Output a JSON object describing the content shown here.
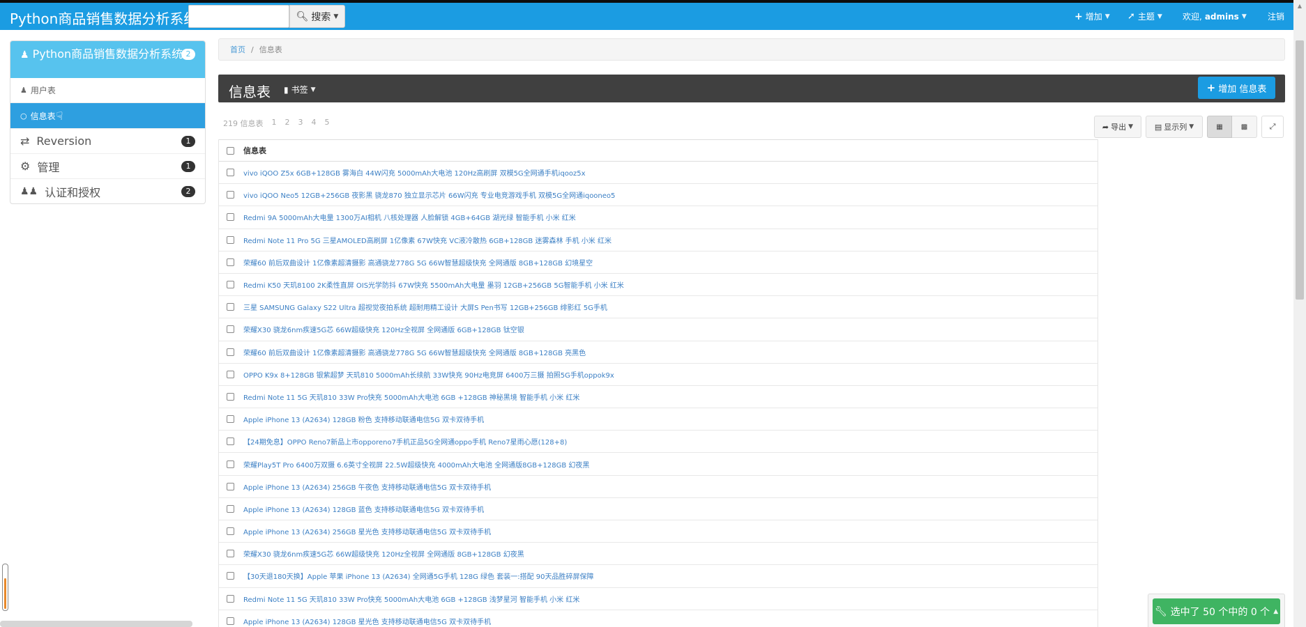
{
  "navbar": {
    "brand": "Python商品销售数据分析系统",
    "search_value": "",
    "search_label": "搜索",
    "add_label": "增加",
    "theme_label": "主题",
    "welcome_label": "欢迎,",
    "user_label": "admins",
    "logout_label": "注销"
  },
  "sidebar": {
    "header": "Python商品销售数据分析系统",
    "header_badge": "2",
    "sub_items": [
      {
        "label": "用户表"
      },
      {
        "label": "信息表"
      }
    ],
    "items": [
      {
        "label": "Reversion",
        "badge": "1"
      },
      {
        "label": "管理",
        "badge": "1"
      },
      {
        "label": "认证和授权",
        "badge": "2"
      }
    ]
  },
  "breadcrumb": {
    "home": "首页",
    "separator": "/",
    "current": "信息表"
  },
  "titlebar": {
    "title": "信息表",
    "bookmark": "书签",
    "add_button": "增加 信息表"
  },
  "toolbar": {
    "count": "219 信息表",
    "pages": [
      "1",
      "2",
      "3",
      "4",
      "5"
    ],
    "export": "导出",
    "columns": "显示列"
  },
  "table": {
    "header": "信息表",
    "rows": [
      "vivo iQOO Z5x 6GB+128GB 雾海白 44W闪充 5000mAh大电池 120Hz高刷屏 双模5G全网通手机iqooz5x",
      "vivo iQOO Neo5 12GB+256GB 夜影黑 骁龙870 独立显示芯片 66W闪充 专业电竞游戏手机 双模5G全网通iqooneo5",
      "Redmi 9A 5000mAh大电量 1300万AI相机 八核处理器 人脸解锁 4GB+64GB 湖光绿 智能手机 小米 红米",
      "Redmi Note 11 Pro 5G 三星AMOLED高刷屏 1亿像素 67W快充 VC液冷散热 6GB+128GB 迷雾森林 手机 小米 红米",
      "荣耀60 前后双曲设计 1亿像素超清摄影 高通骁龙778G 5G 66W智慧超级快充 全网通版 8GB+128GB 幻境星空",
      "Redmi K50 天玑8100 2K柔性直屏 OIS光学防抖 67W快充 5500mAh大电量 墨羽 12GB+256GB 5G智能手机 小米 红米",
      "三星 SAMSUNG Galaxy S22 Ultra 超视觉夜拍系统 超耐用精工设计 大屏S Pen书写 12GB+256GB 绯影红 5G手机",
      "荣耀X30 骁龙6nm疾速5G芯 66W超级快充 120Hz全视屏 全网通版 6GB+128GB 钛空银",
      "荣耀60 前后双曲设计 1亿像素超清摄影 高通骁龙778G 5G 66W智慧超级快充 全网通版 8GB+128GB 亮黑色",
      "OPPO K9x 8+128GB 银紫超梦 天玑810 5000mAh长续航 33W快充 90Hz电竞屏 6400万三摄 拍照5G手机oppok9x",
      "Redmi Note 11 5G 天玑810 33W Pro快充 5000mAh大电池 6GB +128GB 神秘黑境 智能手机 小米 红米",
      "Apple iPhone 13 (A2634) 128GB 粉色 支持移动联通电信5G 双卡双待手机",
      "【24期免息】OPPO Reno7新品上市opporeno7手机正品5G全网通oppo手机 Reno7星雨心愿(128+8)",
      "荣耀Play5T Pro 6400万双摄 6.6英寸全视屏 22.5W超级快充 4000mAh大电池 全网通版8GB+128GB 幻夜黑",
      "Apple iPhone 13 (A2634) 256GB 午夜色 支持移动联通电信5G 双卡双待手机",
      "Apple iPhone 13 (A2634) 128GB 蓝色 支持移动联通电信5G 双卡双待手机",
      "Apple iPhone 13 (A2634) 256GB 星光色 支持移动联通电信5G 双卡双待手机",
      "荣耀X30 骁龙6nm疾速5G芯 66W超级快充 120Hz全视屏 全网通版 8GB+128GB 幻夜黑",
      "【30天退180天换】Apple 苹果 iPhone 13 (A2634) 全网通5G手机 128G 绿色 套装一:搭配 90天品胜碎屏保障",
      "Redmi Note 11 5G 天玑810 33W Pro快充 5000mAh大电池 6GB +128GB 浅梦星河 智能手机 小米 红米",
      "Apple iPhone 13 (A2634) 128GB 星光色 支持移动联通电信5G 双卡双待手机"
    ]
  },
  "action": {
    "label": "选中了 50 个中的 0 个"
  },
  "colors": {
    "navbar": "#1b9ce2",
    "sidebar_header": "#57c3ee",
    "active_item": "#2e9fe0",
    "titlebar": "#404040",
    "action_button": "#3fb462",
    "link": "#3b7fc4"
  }
}
